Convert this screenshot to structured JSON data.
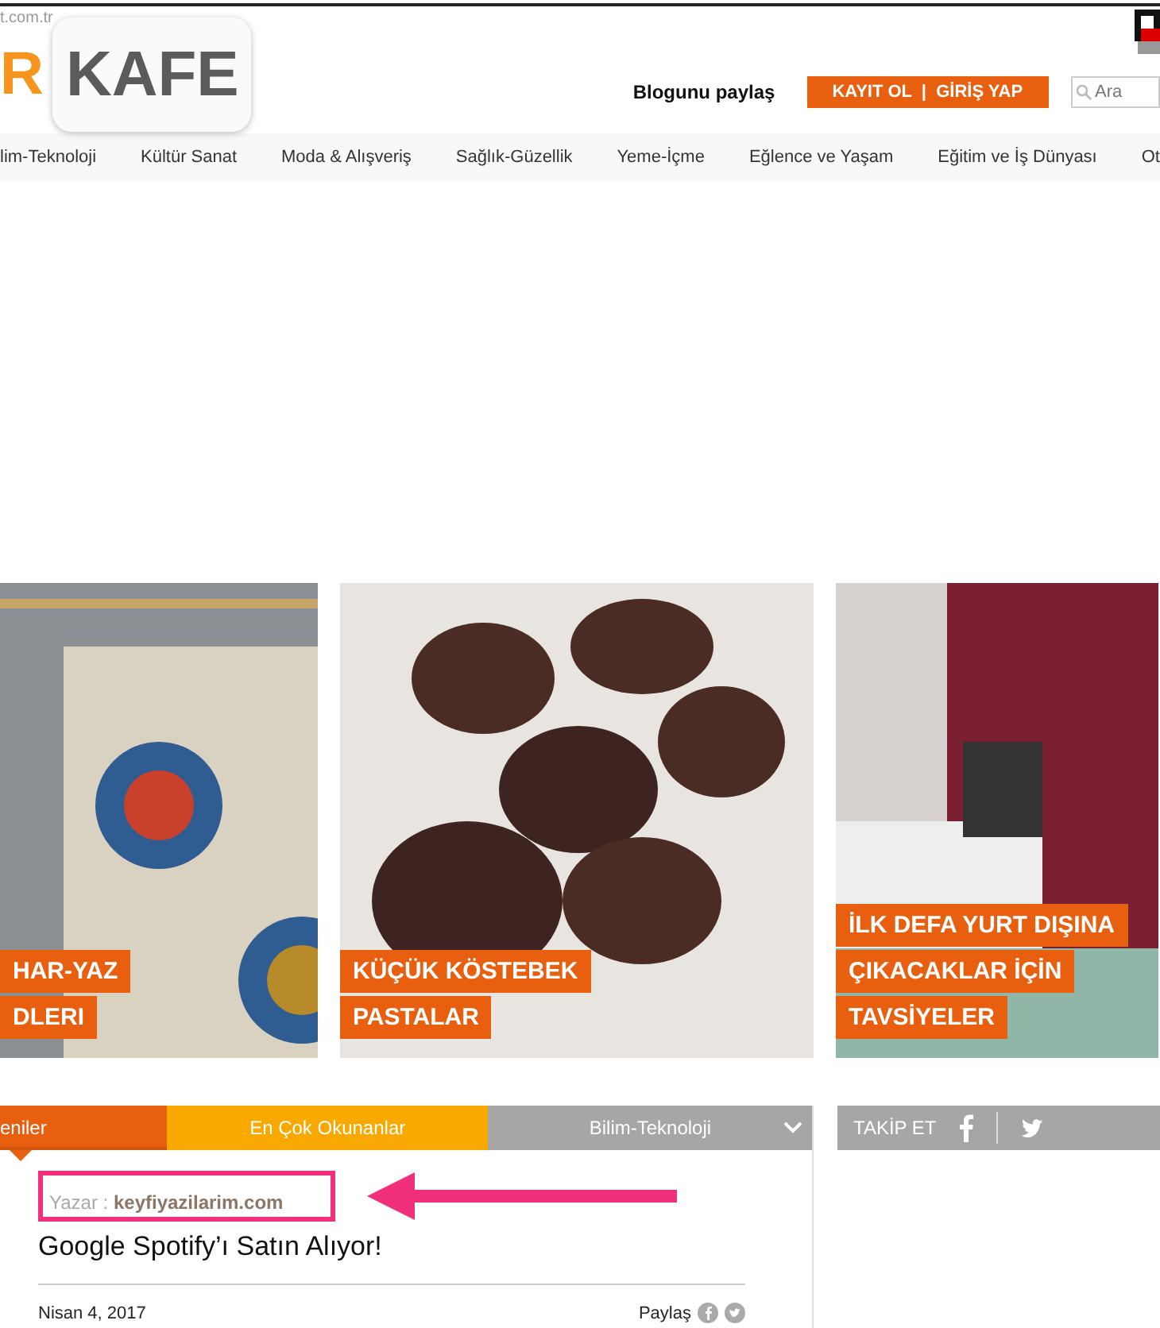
{
  "url_fragment": "t.com.tr",
  "logo": {
    "letter": "R",
    "word": "KAFE"
  },
  "header": {
    "tagline": "Blogunu paylaş",
    "register": "KAYIT OL",
    "separator": "|",
    "login": "GİRİŞ YAP",
    "search": {
      "placeholder": "Ara"
    }
  },
  "nav": [
    "lim-Teknoloji",
    "Kültür Sanat",
    "Moda & Alışveriş",
    "Sağlık-Güzellik",
    "Yeme-İçme",
    "Eğlence ve Yaşam",
    "Eğitim ve İş Dünyası",
    "Ot"
  ],
  "tiles": [
    {
      "kind": "crochet",
      "lines": [
        "HAR-YAZ",
        "DLERI"
      ]
    },
    {
      "kind": "cake",
      "lines": [
        "KÜÇÜK KÖSTEBEK",
        "PASTALAR"
      ]
    },
    {
      "kind": "passport",
      "lines": [
        "İLK DEFA YURT DIŞINA",
        "ÇIKACAKLAR İÇİN",
        "TAVSİYELER"
      ]
    }
  ],
  "tabs": [
    {
      "label": "eniler",
      "selected": true,
      "color": "#e8600f"
    },
    {
      "label": "En Çok Okunanlar",
      "selected": false,
      "color": "#f9a800"
    },
    {
      "label": "Bilim-Teknoloji",
      "selected": false,
      "color": "#a6a6a6",
      "dropdown": true
    }
  ],
  "article": {
    "author_label": "Yazar :",
    "author": "keyfiyazilarim.com",
    "title": "Google Spotify’ı Satın Alıyor!",
    "date": "Nisan 4, 2017",
    "share": "Paylaş"
  },
  "follow": {
    "label": "TAKİP ET"
  }
}
